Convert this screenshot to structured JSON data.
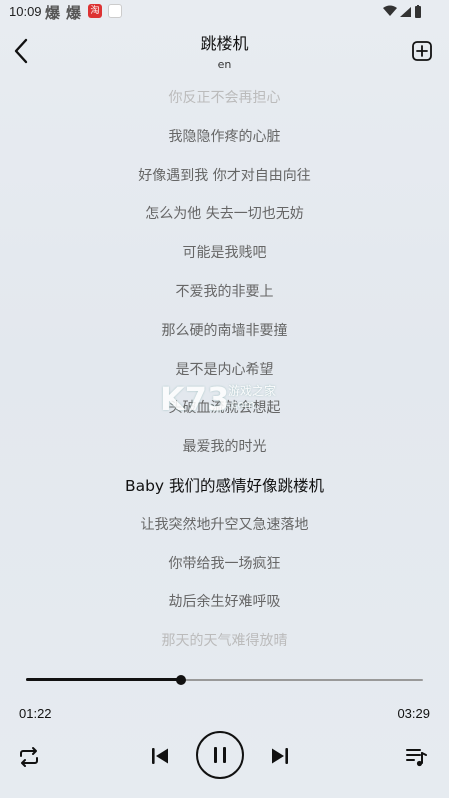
{
  "status": {
    "time": "10:09",
    "notif1": "爆",
    "notif2": "爆",
    "app_badge": "淘"
  },
  "header": {
    "title": "跳楼机",
    "subtitle": "en"
  },
  "lyrics": [
    "你反正不会再担心",
    "我隐隐作疼的心脏",
    "好像遇到我 你才对自由向往",
    "怎么为他 失去一切也无妨",
    "可能是我贱吧",
    "不爱我的非要上",
    "那么硬的南墙非要撞",
    "是不是内心希望",
    "头破血流就会想起",
    "最爱我的时光",
    "Baby 我们的感情好像跳楼机",
    "让我突然地升空又急速落地",
    "你带给我一场疯狂",
    "劫后余生好难呼吸",
    "那天的天气难得放晴"
  ],
  "active_line_index": 10,
  "watermark": {
    "logo": "K73",
    "text": "游戏之家",
    "url": ".com"
  },
  "player": {
    "current_time": "01:22",
    "total_time": "03:29",
    "progress": 0.391,
    "playing": true
  },
  "icons": [
    "back-icon",
    "add-to-playlist-icon",
    "repeat-icon",
    "previous-icon",
    "pause-icon",
    "next-icon",
    "playlist-icon"
  ]
}
